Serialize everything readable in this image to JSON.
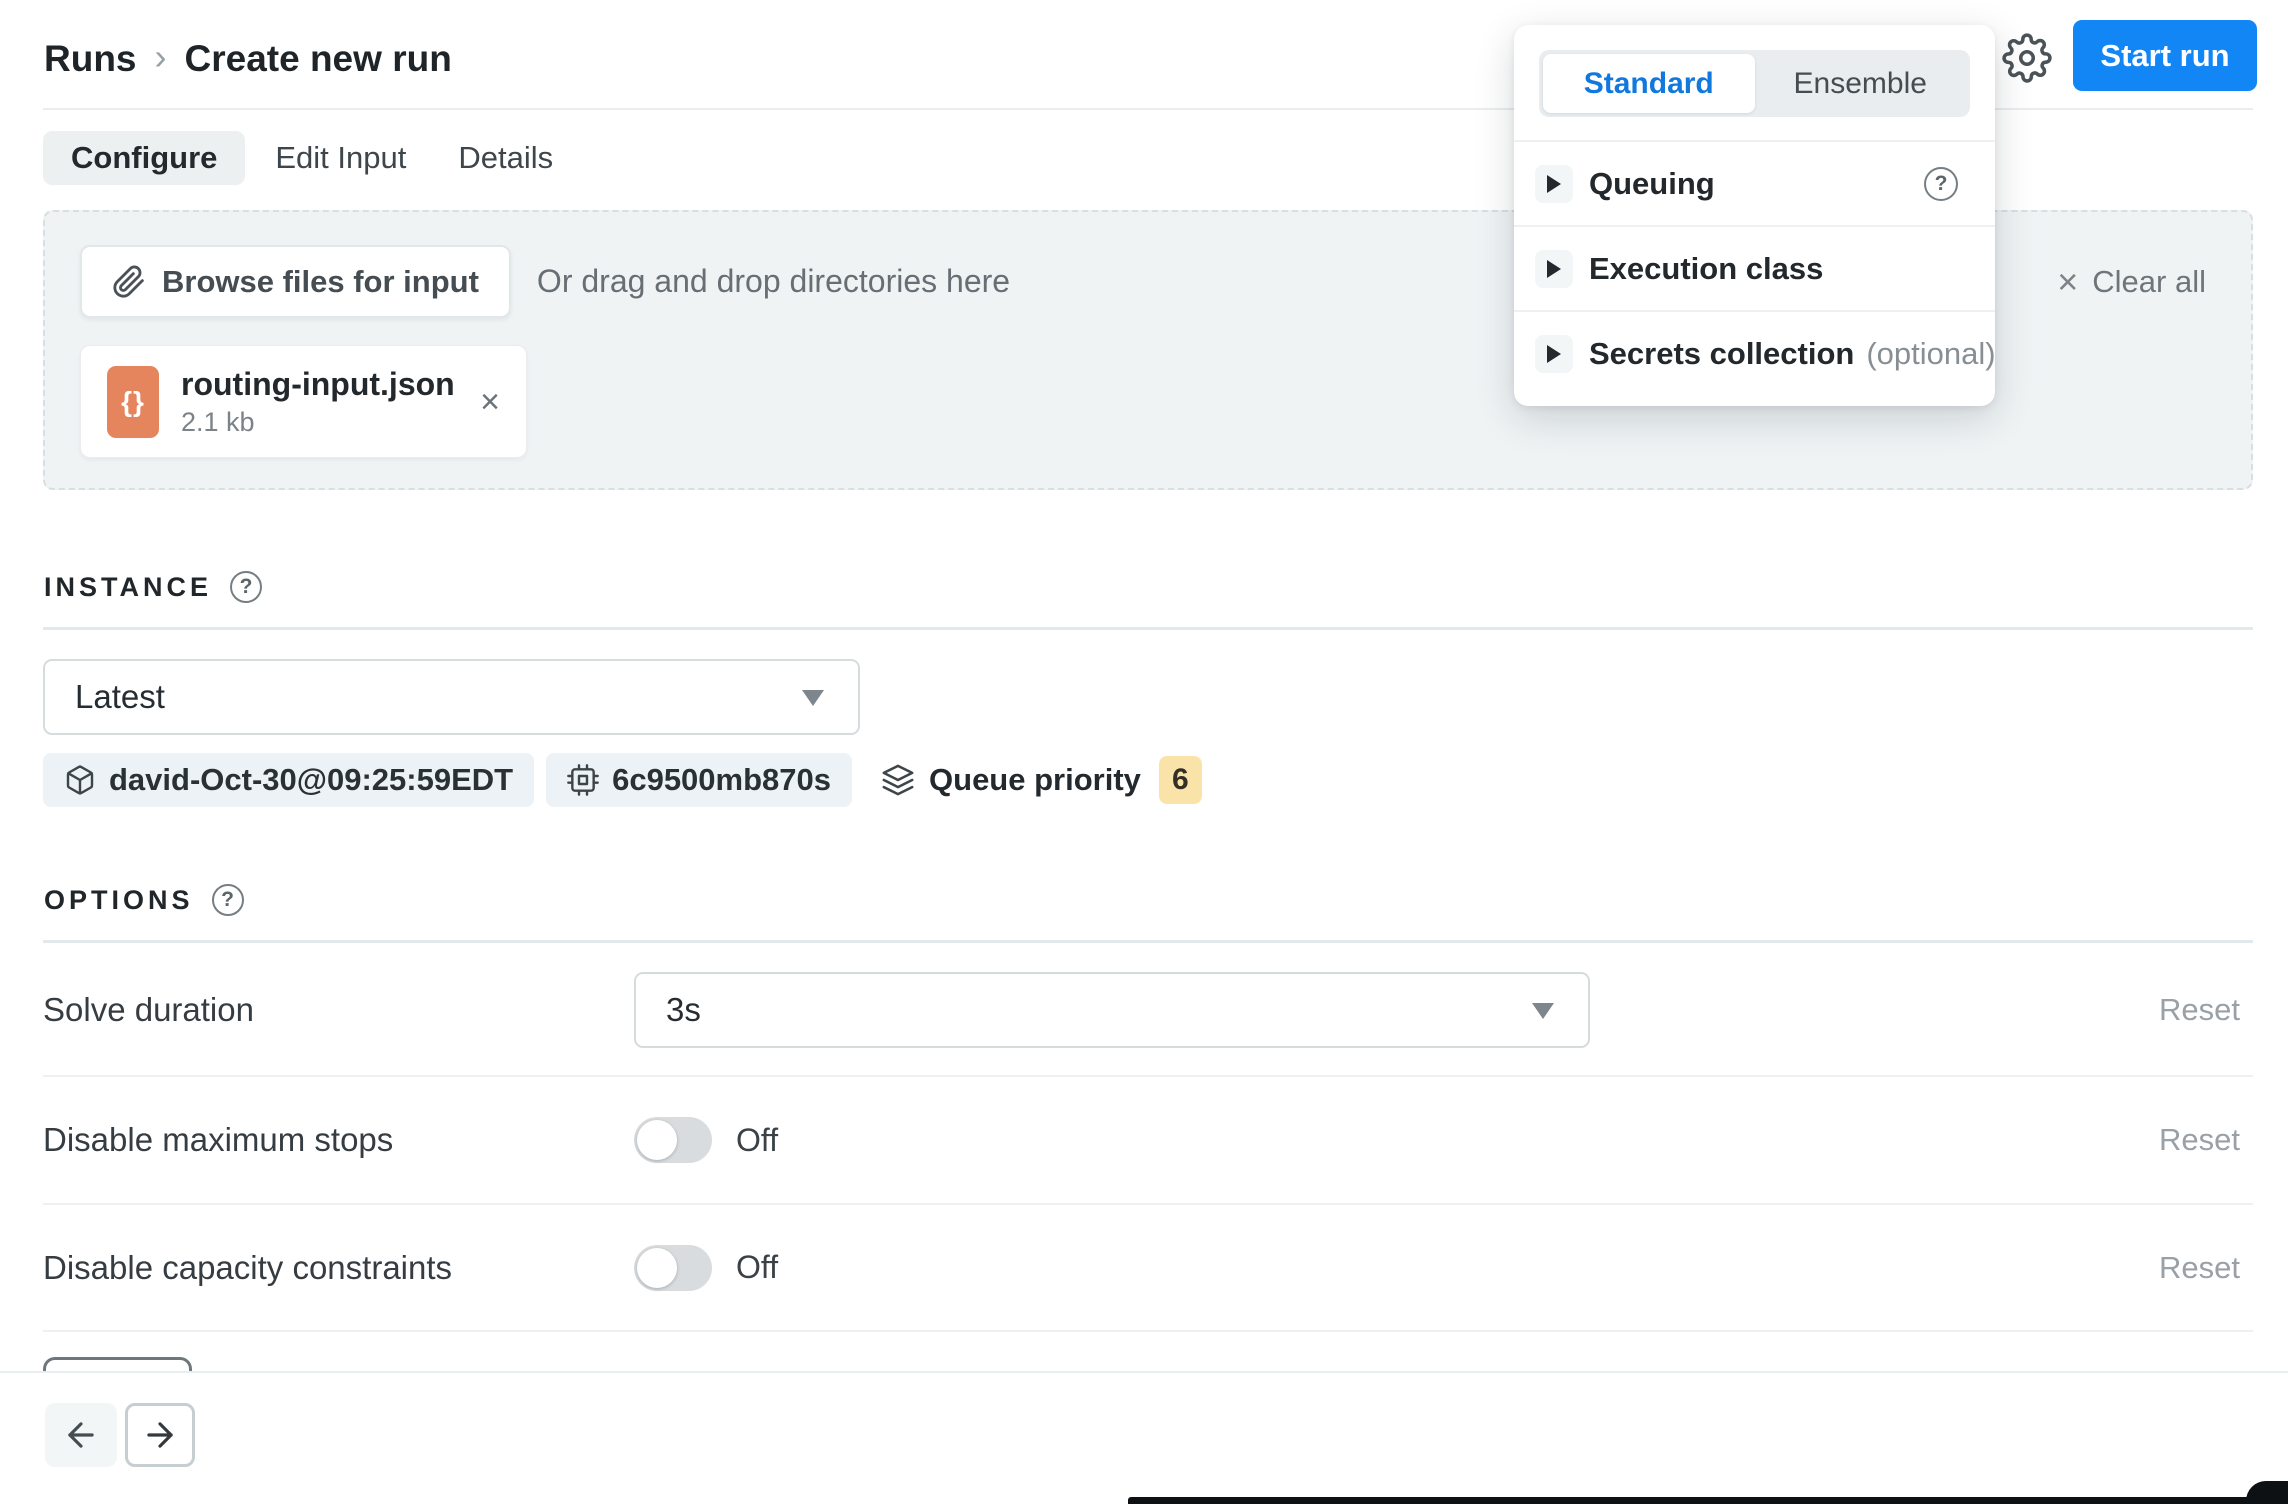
{
  "header": {
    "breadcrumb": {
      "parent": "Runs",
      "separator": "›",
      "current": "Create new run"
    },
    "start_run_label": "Start run"
  },
  "tabs": {
    "configure": "Configure",
    "edit_input": "Edit Input",
    "details": "Details"
  },
  "dropzone": {
    "browse_label": "Browse files for input",
    "drag_label": "Or drag and drop directories here",
    "clear_all_label": "Clear all",
    "file": {
      "name": "routing-input.json",
      "size": "2.1 kb",
      "type_glyph": "{}"
    }
  },
  "run_type_panel": {
    "standard_label": "Standard",
    "ensemble_label": "Ensemble",
    "rows": [
      {
        "label": "Queuing",
        "has_help": true
      },
      {
        "label": "Execution class"
      },
      {
        "label": "Secrets collection",
        "suffix": "(optional)"
      }
    ]
  },
  "instance": {
    "section_label": "INSTANCE",
    "selected_value": "Latest",
    "chips": [
      {
        "icon": "package-icon",
        "label": "david-Oct-30@09:25:59EDT"
      },
      {
        "icon": "cpu-icon",
        "label": "6c9500mb870s"
      }
    ],
    "queue_priority": {
      "icon": "layers-icon",
      "label": "Queue priority",
      "value": "6"
    }
  },
  "options": {
    "section_label": "OPTIONS",
    "rows": [
      {
        "label": "Solve duration",
        "value": "3s",
        "reset_label": "Reset"
      },
      {
        "label": "Disable maximum stops",
        "state": "Off",
        "reset_label": "Reset"
      },
      {
        "label": "Disable capacity constraints",
        "state": "Off",
        "reset_label": "Reset"
      }
    ]
  },
  "icons": {
    "help_glyph": "?",
    "close_glyph": "×"
  },
  "colors": {
    "accent_blue": "#1286f5",
    "standard_tab_blue": "#1179dd",
    "badge_yellow": "#fae3a9",
    "file_icon_orange": "#e5855e",
    "dropzone_bg": "#eff3f4",
    "chip_bg": "#ecf2f5"
  }
}
